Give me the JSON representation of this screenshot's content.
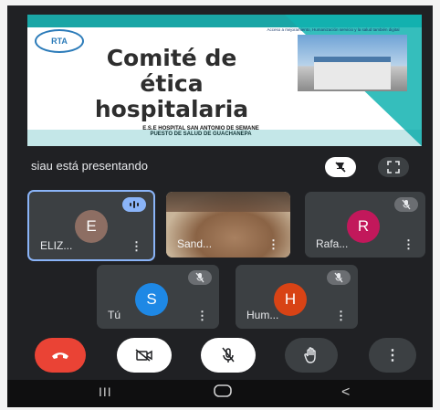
{
  "presentation": {
    "title_lines": [
      "Comité de",
      "ética",
      "hospitalaria"
    ],
    "logo_text": "RTA",
    "hospital_line1": "E.S.E HOSPITAL SAN ANTONIO DE SEMANE",
    "hospital_line2": "PUESTO DE SALUD DE GUACHANEPA",
    "top_text": "Acceso a mejoramiento, Humanización servicio y la salud también digital"
  },
  "presenter_label": "siau está presentando",
  "participants": [
    {
      "name": "ELIZ...",
      "initial": "E",
      "color": "#8d6e63"
    },
    {
      "name": "Sand...",
      "initial": "",
      "color": "#c9b59a"
    },
    {
      "name": "Rafa...",
      "initial": "R",
      "color": "#c2185b"
    },
    {
      "name": "Tú",
      "initial": "S",
      "color": "#1e88e5"
    },
    {
      "name": "Hum...",
      "initial": "H",
      "color": "#d84315"
    }
  ],
  "colors": {
    "end_call": "#ea4335",
    "controls_bg": "#3c4043",
    "white_btn": "#ffffff",
    "speaking_border": "#8ab4f8"
  },
  "nav": {
    "recent": "III",
    "home": "O",
    "back": "<"
  }
}
